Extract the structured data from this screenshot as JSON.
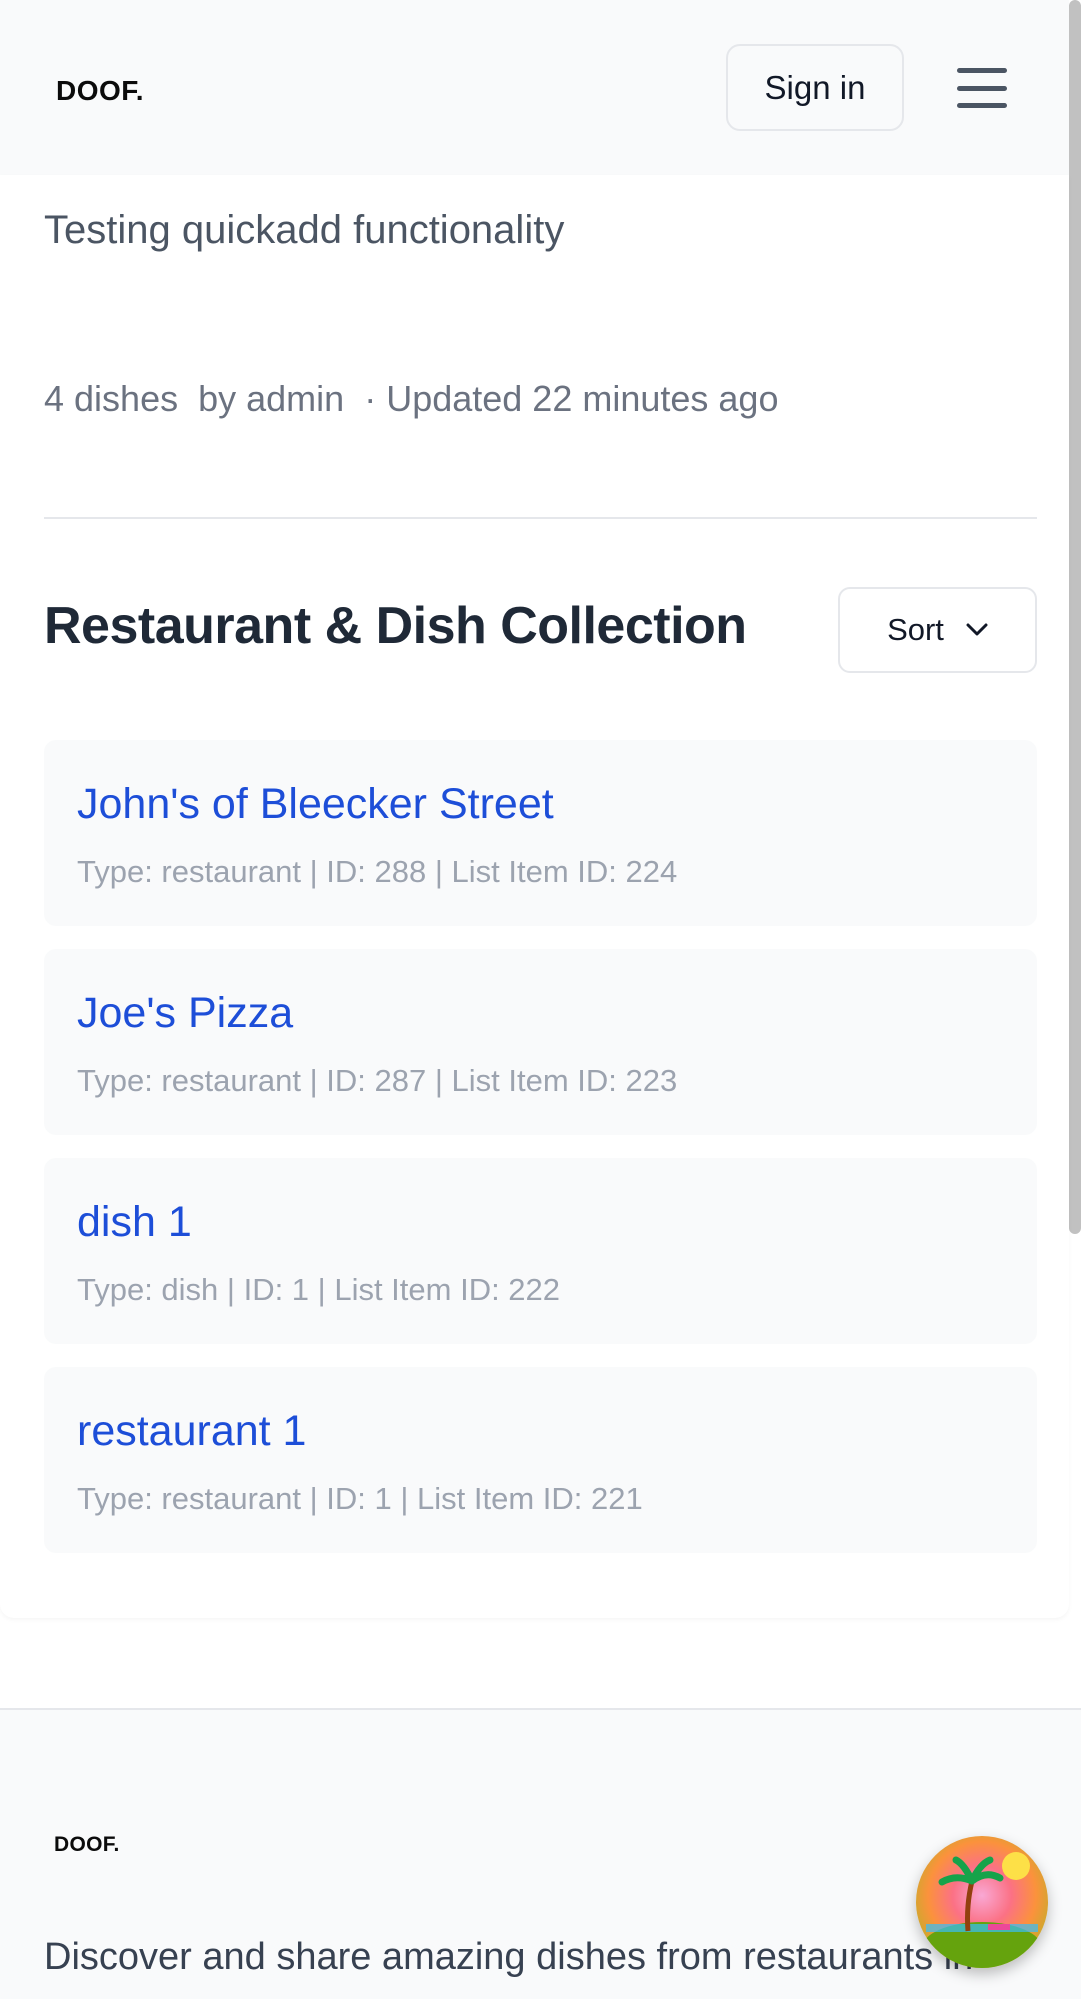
{
  "header": {
    "logo": "DOOF.",
    "signin_label": "Sign in",
    "menu_icon": "hamburger-menu-icon"
  },
  "list": {
    "description": "Testing quickadd functionality",
    "dish_count": "4 dishes",
    "author": "by admin",
    "updated": "· Updated 22 minutes ago"
  },
  "collection": {
    "title": "Restaurant & Dish Collection",
    "sort_label": "Sort",
    "items": [
      {
        "name": "John's of Bleecker Street",
        "meta": "Type: restaurant | ID: 288 | List Item ID: 224"
      },
      {
        "name": "Joe's Pizza",
        "meta": "Type: restaurant | ID: 287 | List Item ID: 223"
      },
      {
        "name": "dish 1",
        "meta": "Type: dish | ID: 1 | List Item ID: 222"
      },
      {
        "name": "restaurant 1",
        "meta": "Type: restaurant | ID: 1 | List Item ID: 221"
      }
    ]
  },
  "footer": {
    "logo": "DOOF.",
    "tagline": "Discover and share amazing dishes from restaurants in"
  },
  "fab": {
    "icon": "island-beach-icon"
  },
  "colors": {
    "link": "#1d4ed8",
    "muted": "#9ca3af",
    "surface": "#f9fafb"
  }
}
